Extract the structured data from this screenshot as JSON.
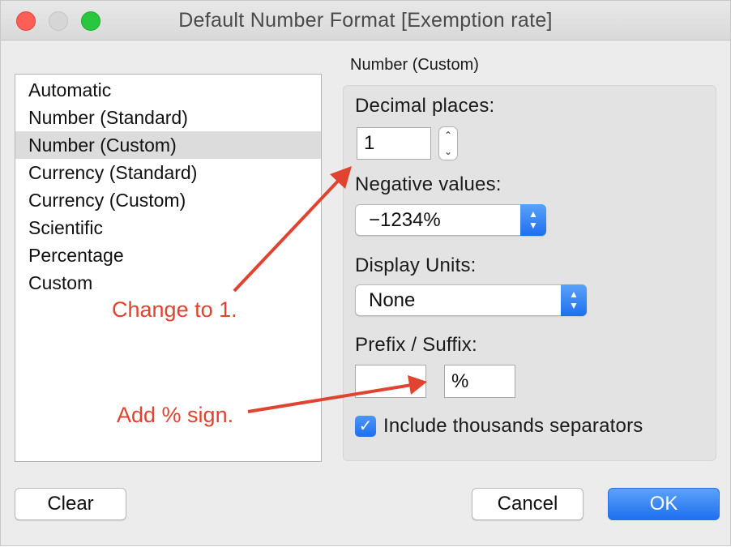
{
  "window": {
    "title": "Default Number Format [Exemption rate]"
  },
  "format_list": {
    "items": [
      {
        "label": "Automatic",
        "selected": false
      },
      {
        "label": "Number (Standard)",
        "selected": false
      },
      {
        "label": "Number (Custom)",
        "selected": true
      },
      {
        "label": "Currency (Standard)",
        "selected": false
      },
      {
        "label": "Currency (Custom)",
        "selected": false
      },
      {
        "label": "Scientific",
        "selected": false
      },
      {
        "label": "Percentage",
        "selected": false
      },
      {
        "label": "Custom",
        "selected": false
      }
    ]
  },
  "panel": {
    "section_title": "Number (Custom)",
    "decimal_places": {
      "label": "Decimal places:",
      "value": "1"
    },
    "negative_values": {
      "label": "Negative values:",
      "value": "−1234%"
    },
    "display_units": {
      "label": "Display Units:",
      "value": "None"
    },
    "prefix_suffix": {
      "label": "Prefix / Suffix:",
      "prefix": "",
      "suffix": "%"
    },
    "thousands_separator": {
      "label": "Include thousands separators",
      "checked": true
    }
  },
  "buttons": {
    "clear": "Clear",
    "cancel": "Cancel",
    "ok": "OK"
  },
  "annotations": {
    "decimal_note": "Change to 1.",
    "suffix_note": "Add % sign.",
    "color": "#e0432f"
  },
  "colors": {
    "accent": "#1f6ff0",
    "selection": "#dcdcdc"
  },
  "icons": {
    "stepper": "up-down-stepper-icon",
    "popup": "chevron-up-down-icon",
    "checkbox": "checkmark-icon"
  }
}
